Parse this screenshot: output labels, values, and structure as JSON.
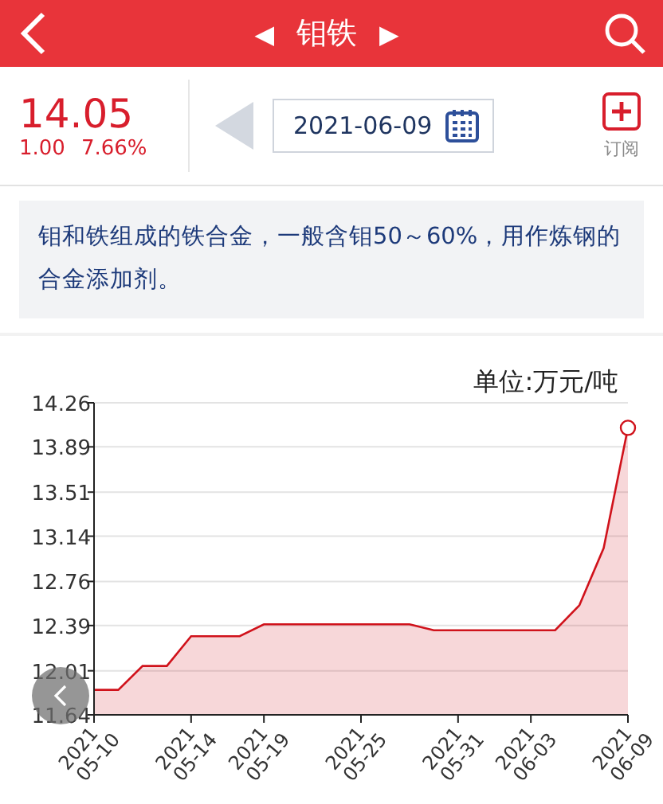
{
  "header": {
    "title": "钼铁",
    "prev": "◀",
    "next": "▶"
  },
  "quote": {
    "price": "14.05",
    "change": "1.00",
    "percent": "7.66%"
  },
  "date_nav": {
    "date": "2021-06-09",
    "prev_disabled": true
  },
  "subscribe": {
    "label": "订阅"
  },
  "description": "钼和铁组成的铁合金，一般含钼50～60%，用作炼钢的合金添加剂。",
  "chart": {
    "unit": "单位:万元/吨",
    "chart_data": {
      "type": "area",
      "categories": [
        "2021 05-10",
        null,
        null,
        null,
        "2021 05-14",
        null,
        null,
        "2021 05-19",
        null,
        null,
        null,
        "2021 05-25",
        null,
        null,
        null,
        "2021 05-31",
        null,
        null,
        "2021 06-03",
        null,
        null,
        null,
        "2021 06-09"
      ],
      "series": [
        {
          "color": "#d0121b",
          "values": [
            11.85,
            11.85,
            12.05,
            12.05,
            12.3,
            12.3,
            12.3,
            12.4,
            12.4,
            12.4,
            12.4,
            12.4,
            12.4,
            12.4,
            12.35,
            12.35,
            12.35,
            12.35,
            12.35,
            12.35,
            12.56,
            13.04,
            14.05
          ]
        }
      ],
      "grid": true,
      "ylim": [
        11.64,
        14.26
      ],
      "yticks": [
        {
          "value": 11.64,
          "label": "11.64"
        },
        {
          "value": 12.01,
          "label": "12.01"
        },
        {
          "value": 12.39,
          "label": "12.39"
        },
        {
          "value": 12.76,
          "label": "12.76"
        },
        {
          "value": 13.14,
          "label": "13.14"
        },
        {
          "value": 13.51,
          "label": "13.51"
        },
        {
          "value": 13.89,
          "label": "13.89"
        },
        {
          "value": 14.26,
          "label": "14.26"
        }
      ]
    }
  }
}
